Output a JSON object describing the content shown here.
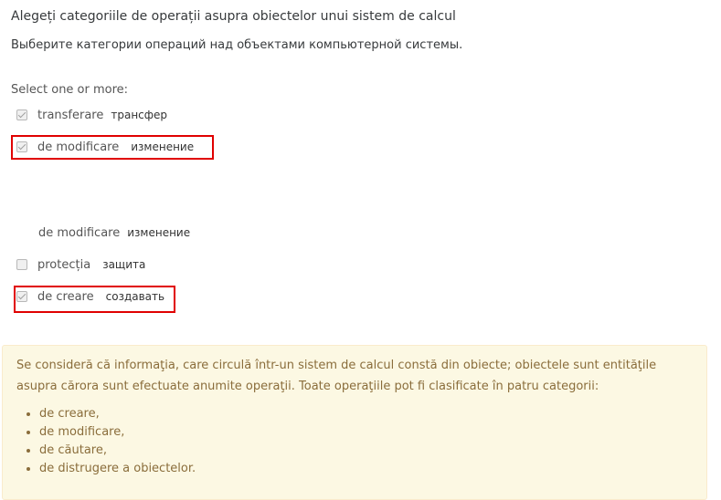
{
  "question": {
    "text_ro": "Alegeți categoriile de operații asupra obiectelor unui sistem de calcul",
    "text_ru": "Выберите категории операций над объектами компьютерной системы."
  },
  "prompt": "Select one or more:",
  "options": [
    {
      "ro": "transferare",
      "ru": "трансфер",
      "checked": true,
      "highlighted": false
    },
    {
      "ro": "de modificare",
      "ru": "изменение",
      "checked": true,
      "highlighted": true
    },
    {
      "ro": "de modificare",
      "ru": "изменение",
      "checked": false,
      "highlighted": false,
      "no_checkbox": true
    },
    {
      "ro": "protecția",
      "ru": "защита",
      "checked": false,
      "highlighted": false
    },
    {
      "ro": "de creare",
      "ru": "создавать",
      "checked": true,
      "highlighted": true
    }
  ],
  "feedback": {
    "text": "Se consideră că informaţia, care circulă într-un sistem de calcul constă din obiecte; obiectele sunt entităţile asupra cărora sunt efectuate anumite operaţii. Toate operaţiile pot fi clasificate în patru categorii:",
    "items": [
      "de creare,",
      "de modificare,",
      "de căutare,",
      "de distrugere a obiectelor."
    ]
  },
  "colors": {
    "highlight": "#e00000",
    "feedback_bg": "#fcf8e3",
    "feedback_text": "#8a6d3b"
  }
}
